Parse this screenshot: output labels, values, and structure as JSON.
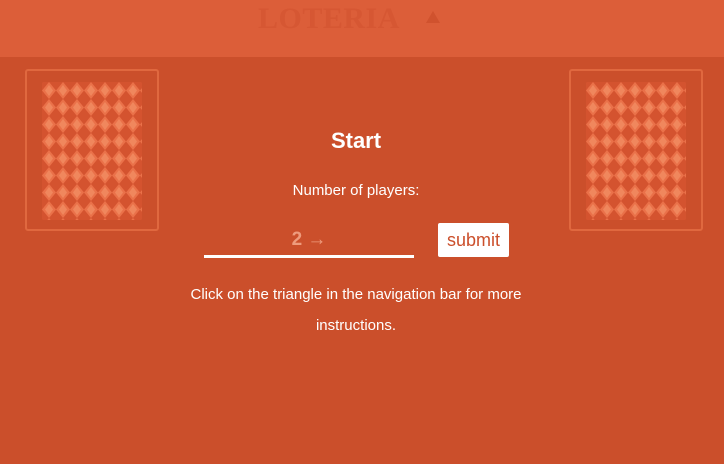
{
  "navbar": {
    "title": "LOTERIA",
    "triangle_icon": "triangle-up-icon"
  },
  "main": {
    "heading": "Start",
    "players_label": "Number of players:",
    "players_input_value": "",
    "players_input_placeholder": "2 →",
    "submit_label": "submit",
    "instructions": "Click on the triangle in the navigation bar for more instructions."
  },
  "colors": {
    "background": "#cb4f2b",
    "navbar": "#dc5e39",
    "card_border": "#e0683f",
    "text": "#ffffff",
    "placeholder": "#ee9b7d"
  }
}
